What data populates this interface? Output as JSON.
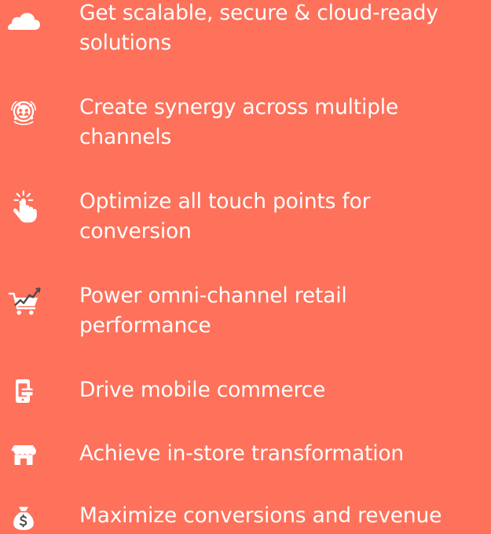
{
  "colors": {
    "background": "#fe715b",
    "text": "#ffffff",
    "icon_accent": "#4d4d4d"
  },
  "features": [
    {
      "icon": "cloud-icon",
      "text": "Get scalable, secure & cloud-ready solutions"
    },
    {
      "icon": "people-network-icon",
      "text": "Create synergy across multiple channels"
    },
    {
      "icon": "tap-hand-icon",
      "text": "Optimize all touch points for conversion"
    },
    {
      "icon": "cart-growth-icon",
      "text": "Power omni-channel retail performance"
    },
    {
      "icon": "mobile-card-icon",
      "text": "Drive mobile commerce"
    },
    {
      "icon": "storefront-icon",
      "text": "Achieve in-store transformation"
    },
    {
      "icon": "money-bag-icon",
      "text": "Maximize conversions and revenue"
    }
  ]
}
